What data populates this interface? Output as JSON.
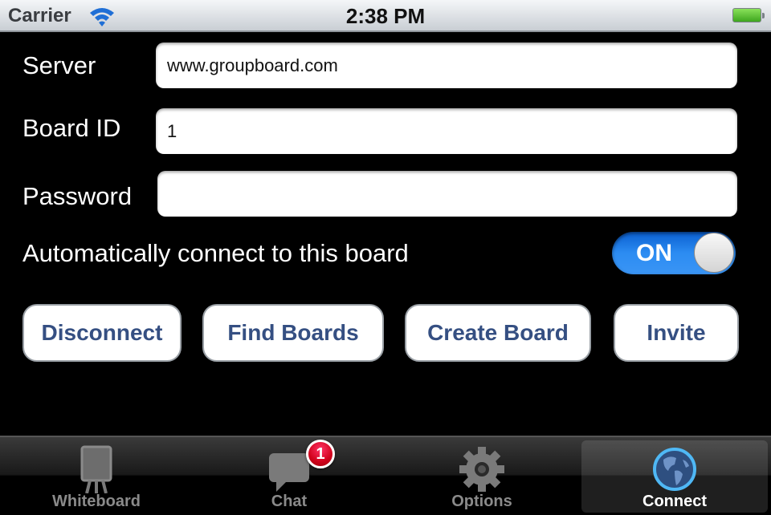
{
  "status_bar": {
    "carrier": "Carrier",
    "time": "2:38 PM",
    "battery_level": 1.0
  },
  "form": {
    "server": {
      "label": "Server",
      "value": "www.groupboard.com",
      "placeholder": ""
    },
    "board_id": {
      "label": "Board ID",
      "value": "1",
      "placeholder": ""
    },
    "password": {
      "label": "Password",
      "value": "",
      "placeholder": ""
    },
    "auto_connect": {
      "label": "Automatically connect to this board",
      "state": "ON",
      "on": true
    }
  },
  "buttons": {
    "disconnect": "Disconnect",
    "find_boards": "Find Boards",
    "create_board": "Create Board",
    "invite": "Invite"
  },
  "tab_bar": {
    "tabs": [
      {
        "label": "Whiteboard",
        "icon": "easel-icon",
        "active": false
      },
      {
        "label": "Chat",
        "icon": "chat-bubble-icon",
        "active": false,
        "badge": "1"
      },
      {
        "label": "Options",
        "icon": "gear-icon",
        "active": false
      },
      {
        "label": "Connect",
        "icon": "globe-icon",
        "active": true
      }
    ]
  },
  "colors": {
    "button_text": "#354f82",
    "toggle_on": "#2c8cf2",
    "badge": "#d0021b"
  }
}
